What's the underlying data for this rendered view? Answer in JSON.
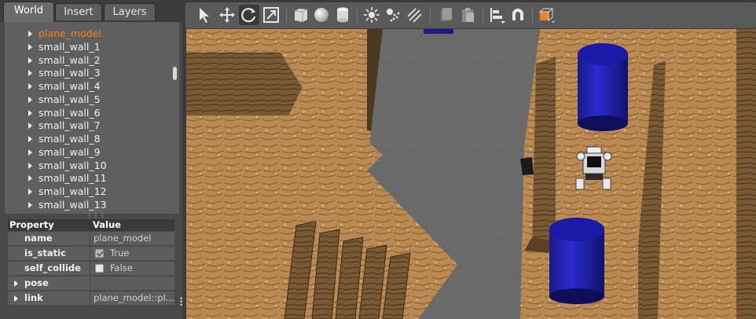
{
  "tabs": [
    {
      "label": "World"
    },
    {
      "label": "Insert"
    },
    {
      "label": "Layers"
    }
  ],
  "tree": {
    "items": [
      {
        "label": "plane_model",
        "selected": true
      },
      {
        "label": "small_wall_1"
      },
      {
        "label": "small_wall_2"
      },
      {
        "label": "small_wall_3"
      },
      {
        "label": "small_wall_4"
      },
      {
        "label": "small_wall_5"
      },
      {
        "label": "small_wall_6"
      },
      {
        "label": "small_wall_7"
      },
      {
        "label": "small_wall_8"
      },
      {
        "label": "small_wall_9"
      },
      {
        "label": "small_wall_10"
      },
      {
        "label": "small_wall_11"
      },
      {
        "label": "small_wall_12"
      },
      {
        "label": "small_wall_13"
      }
    ]
  },
  "properties": {
    "header": {
      "property": "Property",
      "value": "Value"
    },
    "rows": [
      {
        "key": "name",
        "value": "plane_model"
      },
      {
        "key": "is_static",
        "value": "True",
        "checked": true
      },
      {
        "key": "self_collide",
        "value": "False",
        "checked": false
      },
      {
        "key": "pose",
        "value": ""
      },
      {
        "key": "link",
        "value": "plane_model::pl..."
      }
    ]
  },
  "toolbar": {
    "icons": [
      "select-arrow-icon",
      "translate-icon",
      "rotate-icon",
      "scale-icon",
      "box-icon",
      "sphere-icon",
      "cylinder-icon",
      "point-light-icon",
      "spot-light-icon",
      "directional-light-icon",
      "copy-icon",
      "paste-icon",
      "align-icon",
      "snap-icon",
      "view-angle-icon"
    ],
    "accent": "#f58220"
  }
}
